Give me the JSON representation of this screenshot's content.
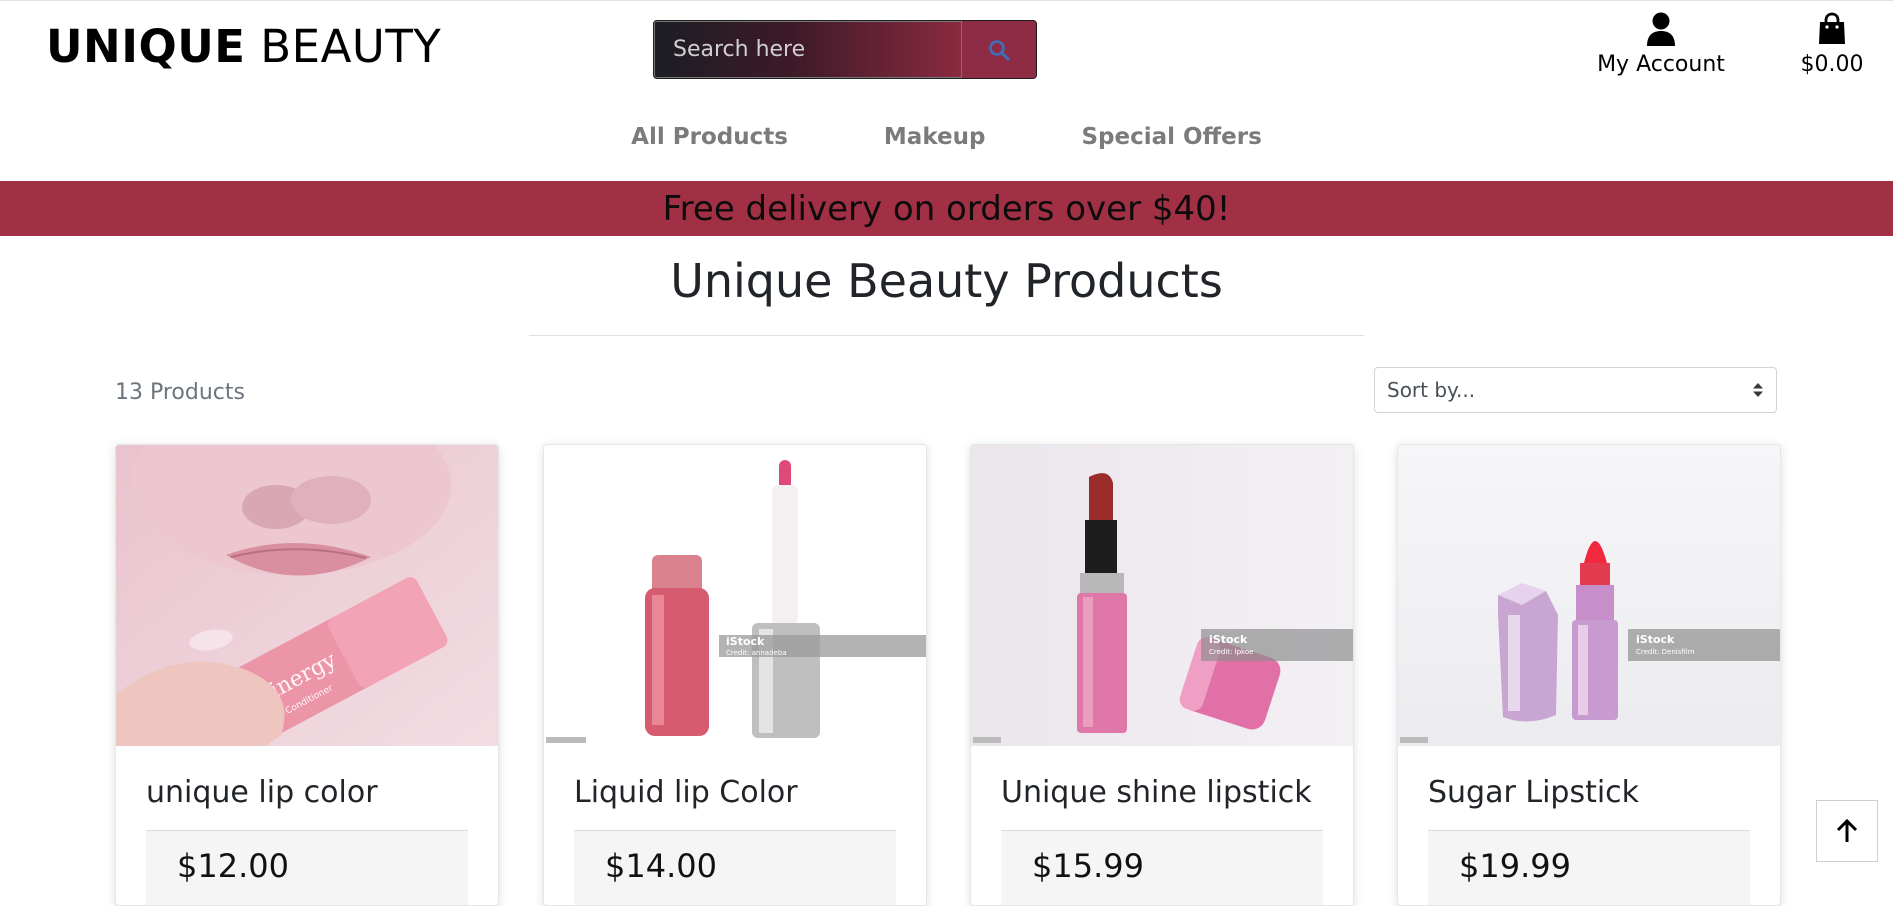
{
  "header": {
    "logo_bold": "UNIQUE",
    "logo_rest": " BEAUTY",
    "search_placeholder": "Search here",
    "account_label": "My Account",
    "cart_total": "$0.00"
  },
  "nav": {
    "items": [
      {
        "label": "All Products"
      },
      {
        "label": "Makeup"
      },
      {
        "label": "Special Offers"
      }
    ]
  },
  "banner": {
    "text": "Free delivery on orders over $40!"
  },
  "main": {
    "title": "Unique Beauty Products",
    "product_count": "13 Products",
    "sort_label": "Sort by..."
  },
  "products": [
    {
      "name": "unique lip color",
      "price": "$12.00",
      "image_text": "skinergy",
      "image_subtext": "Lip Conditioner"
    },
    {
      "name": "Liquid lip Color",
      "price": "$14.00",
      "watermark": "iStock",
      "credit": "Credit: annadeba"
    },
    {
      "name": "Unique shine lipstick",
      "price": "$15.99",
      "watermark": "iStock",
      "credit": "Credit: lpkoe"
    },
    {
      "name": "Sugar Lipstick",
      "price": "$19.99",
      "watermark": "iStock",
      "credit": "Credit: Denisfilm"
    }
  ],
  "colors": {
    "brand": "#a23044",
    "search_button": "#8d2c44",
    "nav_text": "#7b7b7b"
  },
  "icons": {
    "search": "search-icon",
    "account": "user-icon",
    "cart": "shopping-bag-icon",
    "sort": "sort-arrows-icon",
    "back_to_top": "arrow-up-icon"
  }
}
